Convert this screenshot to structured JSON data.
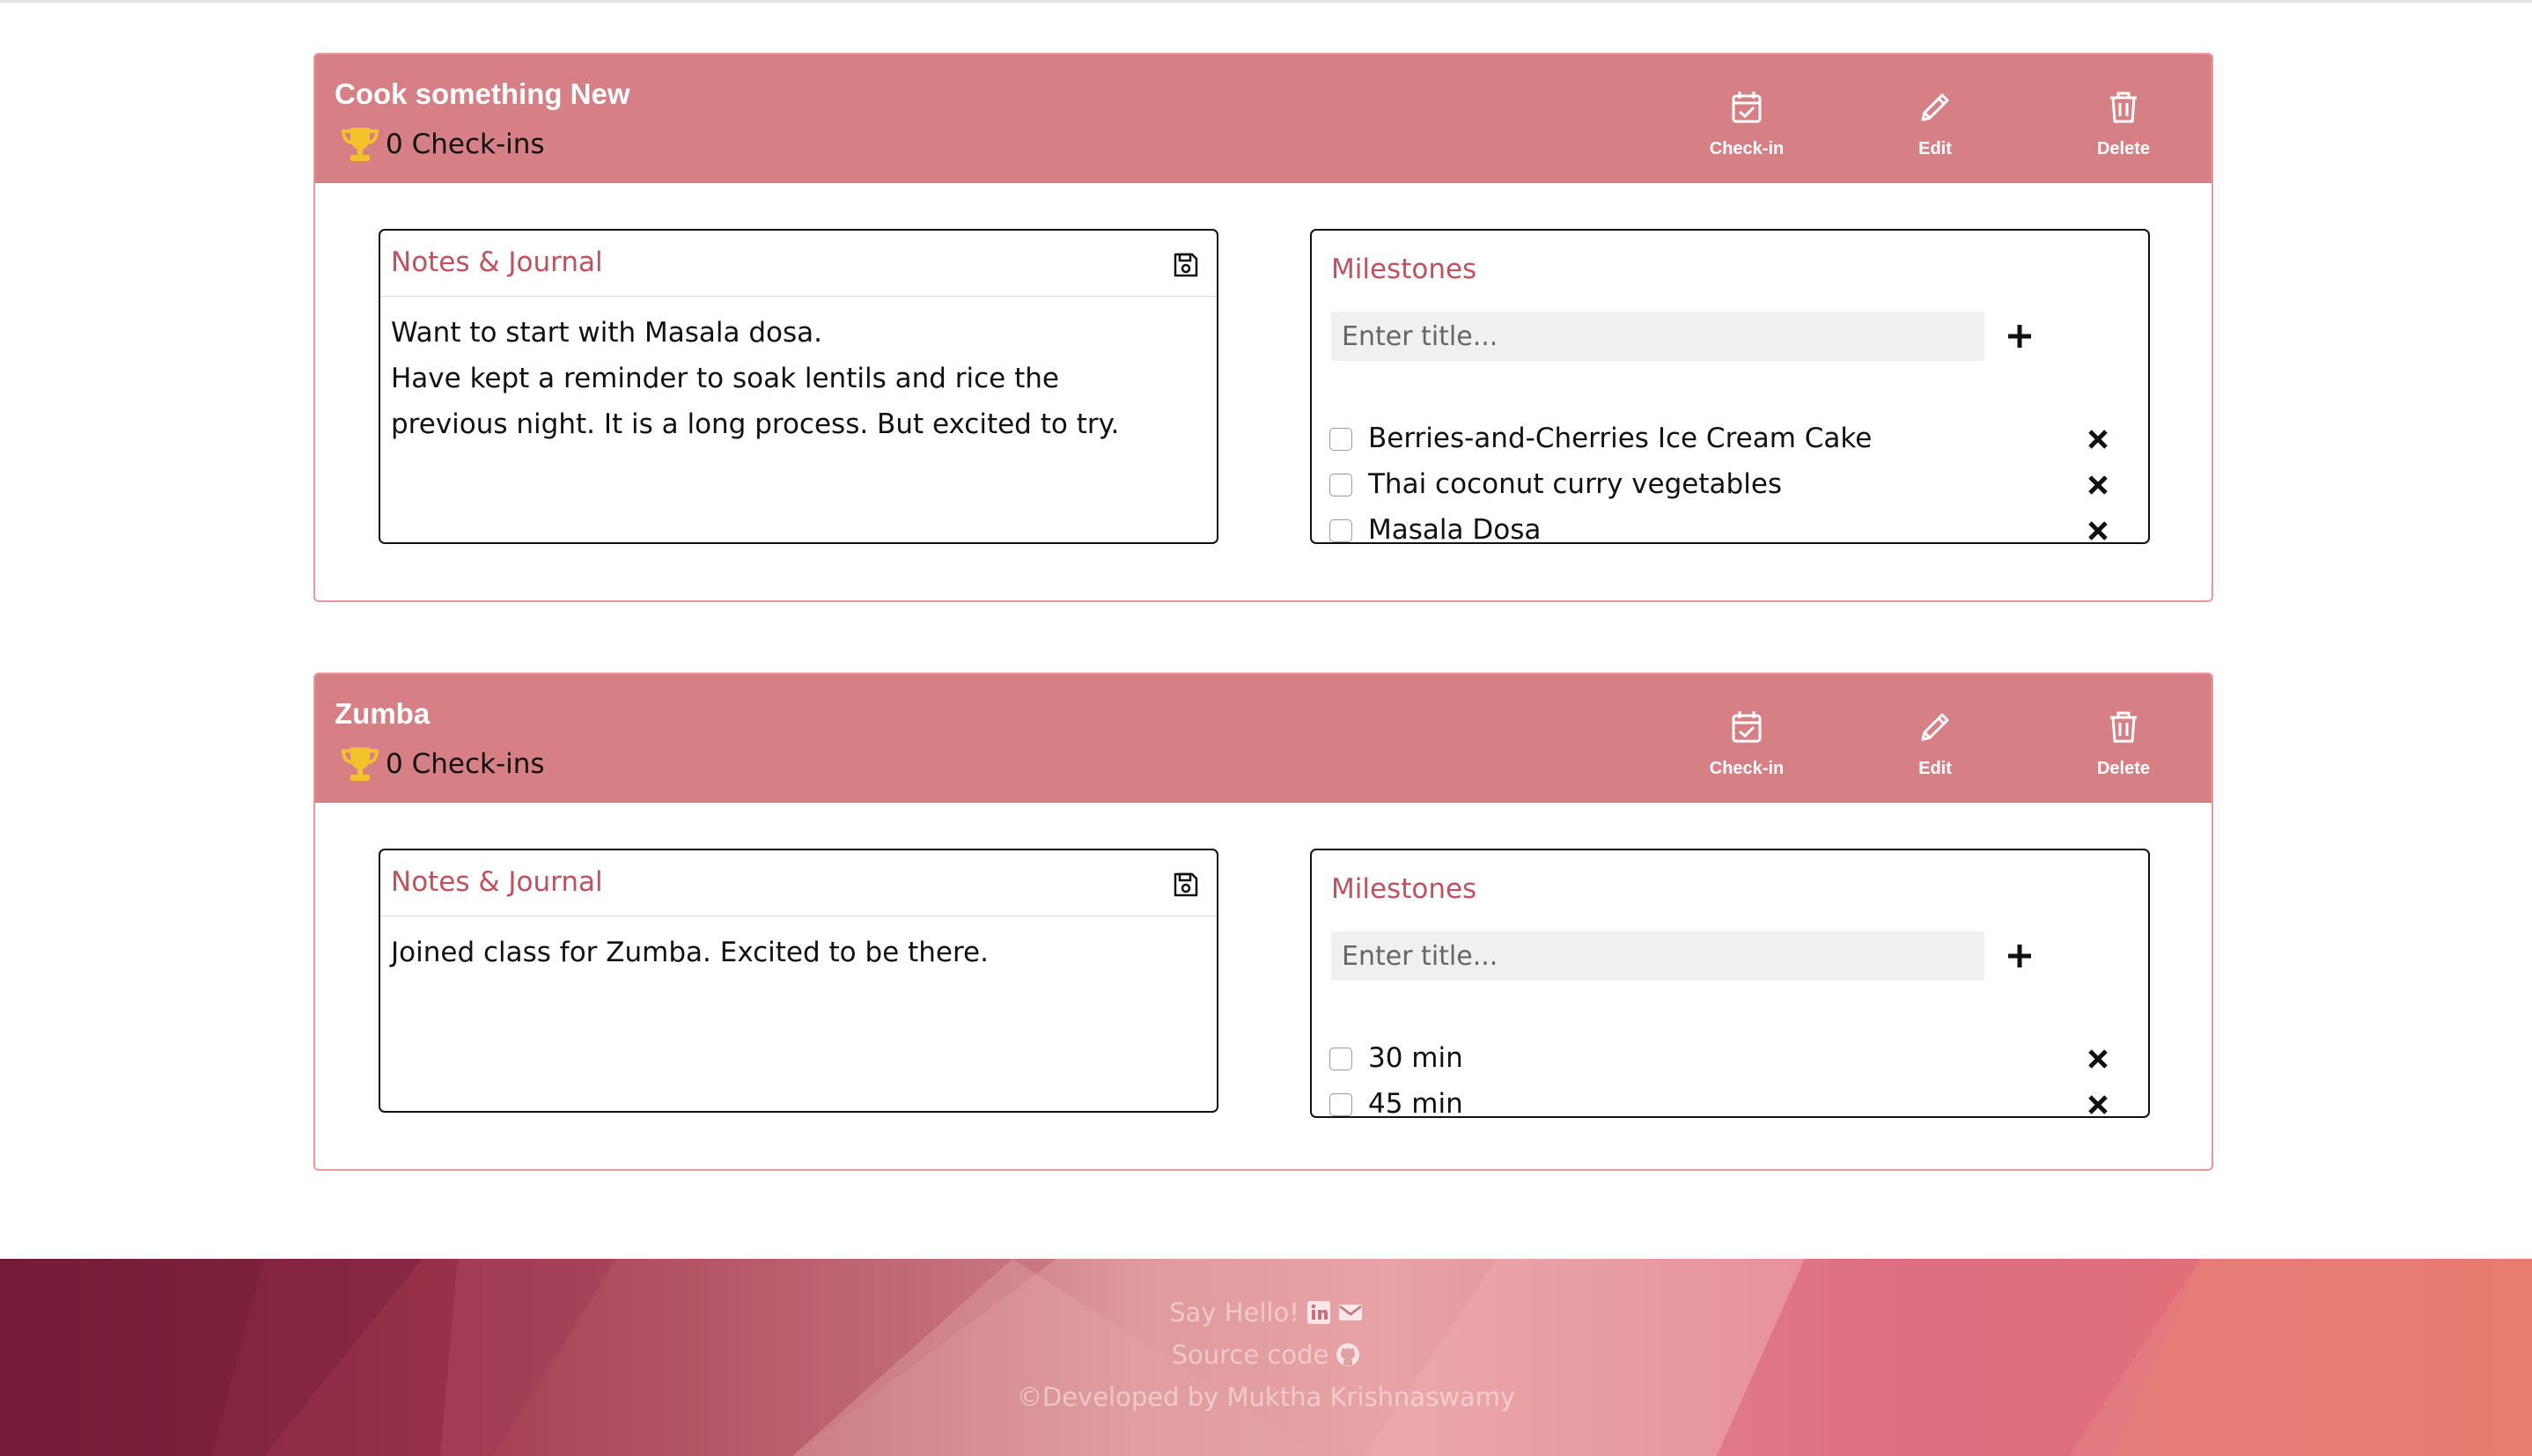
{
  "goals": [
    {
      "title": "Cook something New",
      "checkins_label": "0 Check-ins",
      "actions": {
        "checkin": "Check-in",
        "edit": "Edit",
        "delete": "Delete"
      },
      "notes": {
        "title": "Notes & Journal",
        "text": "Want to start with Masala dosa.\nHave kept a reminder to soak lentils and rice the previous night. It is a long process. But excited to try."
      },
      "milestones": {
        "title": "Milestones",
        "placeholder": "Enter title...",
        "items": [
          {
            "label": "Berries-and-Cherries Ice Cream Cake",
            "checked": false
          },
          {
            "label": "Thai coconut curry vegetables",
            "checked": false
          },
          {
            "label": "Masala Dosa",
            "checked": false
          }
        ]
      }
    },
    {
      "title": "Zumba",
      "checkins_label": "0 Check-ins",
      "actions": {
        "checkin": "Check-in",
        "edit": "Edit",
        "delete": "Delete"
      },
      "notes": {
        "title": "Notes & Journal",
        "text": "Joined class for Zumba. Excited to be there."
      },
      "milestones": {
        "title": "Milestones",
        "placeholder": "Enter title...",
        "items": [
          {
            "label": "30 min",
            "checked": false
          },
          {
            "label": "45 min",
            "checked": false
          }
        ]
      }
    }
  ],
  "footer": {
    "say_hello": "Say Hello!",
    "source_code": "Source code",
    "credit": "©Developed by Muktha Krishnaswamy"
  },
  "colors": {
    "header_bg": "#d67f85",
    "accent_text": "#c1525d",
    "trophy": "#f3c12c"
  },
  "icons": [
    "trophy-icon",
    "calendar-check-icon",
    "pencil-icon",
    "trash-icon",
    "save-icon",
    "plus-icon",
    "close-icon",
    "linkedin-icon",
    "mail-icon",
    "github-icon"
  ]
}
